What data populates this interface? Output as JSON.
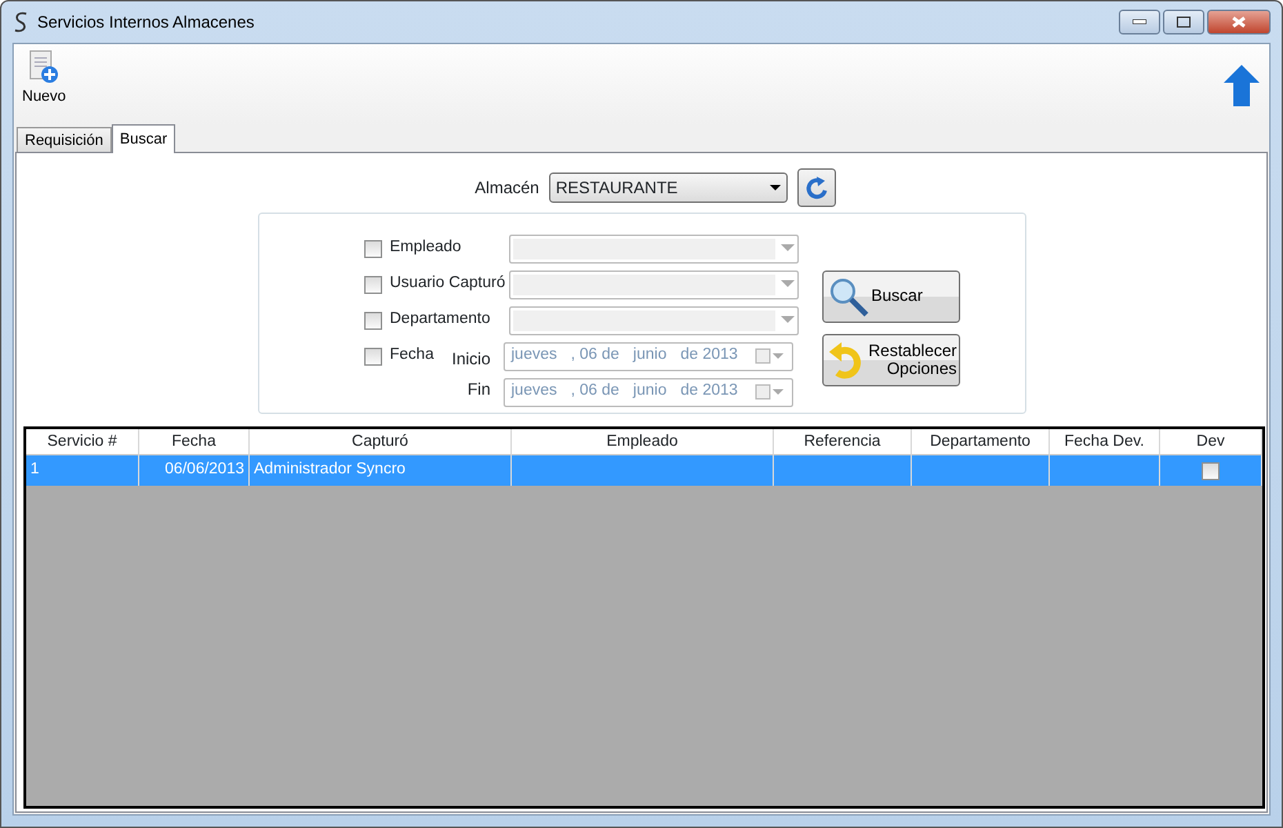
{
  "window": {
    "title": "Servicios Internos Almacenes"
  },
  "toolbar": [
    {
      "label": "Nuevo"
    }
  ],
  "tabs": [
    {
      "label": "Requisición",
      "selected": false
    },
    {
      "label": "Buscar",
      "selected": true
    }
  ],
  "almacen": {
    "label": "Almacén",
    "value": "RESTAURANTE"
  },
  "filters": [
    {
      "kind": "combo",
      "label": "Empleado",
      "checked": false
    },
    {
      "kind": "combo",
      "label": "Usuario Capturó",
      "checked": false
    },
    {
      "kind": "combo",
      "label": "Departamento",
      "checked": false
    },
    {
      "kind": "date",
      "label": "Fecha",
      "checked": false,
      "ranges": [
        {
          "label": "Inicio",
          "parts": [
            "jueves",
            ", 06 de",
            "junio",
            "de 2013"
          ]
        },
        {
          "label": "Fin",
          "parts": [
            "jueves",
            ", 06 de",
            "junio",
            "de 2013"
          ]
        }
      ]
    }
  ],
  "buttons": [
    {
      "kind": "search",
      "label": "Buscar"
    },
    {
      "kind": "reset",
      "label": "Restablecer Opciones"
    }
  ],
  "table": {
    "columns": [
      "Servicio #",
      "Fecha",
      "Capturó",
      "Empleado",
      "Referencia",
      "Departamento",
      "Fecha Dev.",
      "Dev"
    ],
    "rows": [
      {
        "selected": true,
        "cells": [
          "1",
          "06/06/2013",
          "Administrador Syncro",
          "",
          "",
          "",
          ""
        ],
        "dev": false
      }
    ]
  }
}
